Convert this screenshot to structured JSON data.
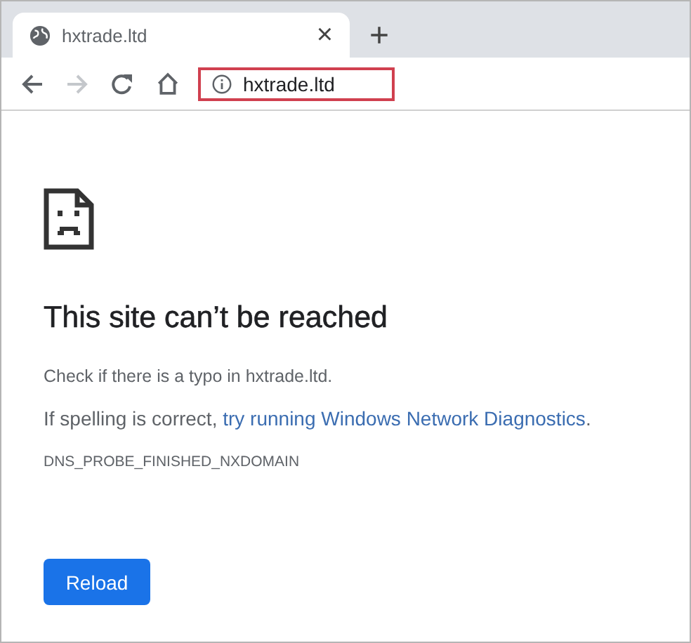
{
  "tab": {
    "title": "hxtrade.ltd",
    "close": "×",
    "selected": true
  },
  "new_tab": "+",
  "toolbar": {
    "forward_disabled": true
  },
  "address_bar": {
    "value": "hxtrade.ltd",
    "highlighted": true
  },
  "error": {
    "title": "This site can’t be reached",
    "hint": "Check if there is a typo in hxtrade.ltd.",
    "suggestion": {
      "before": "If spelling is correct, ",
      "link": "try running Windows Network Diagnostics",
      "after": "."
    },
    "code": "DNS_PROBE_FINISHED_NXDOMAIN",
    "button": "Reload"
  }
}
